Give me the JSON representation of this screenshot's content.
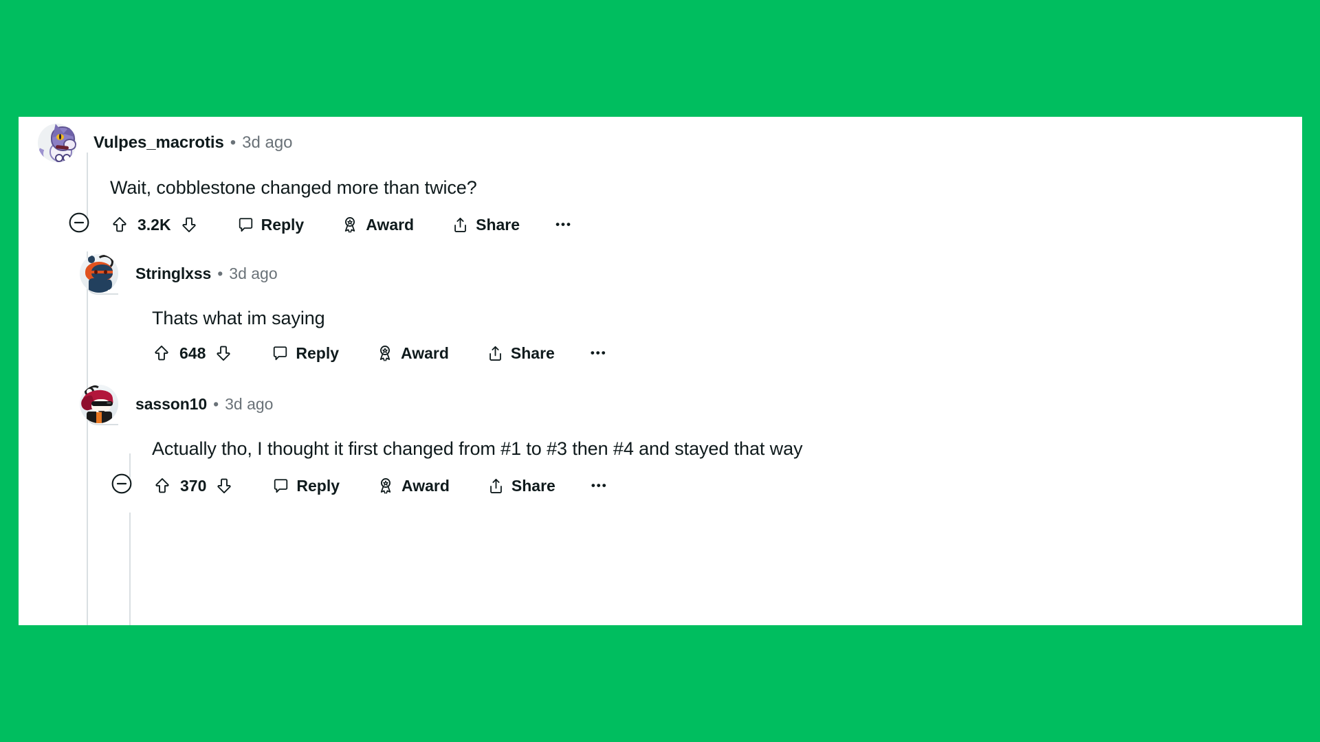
{
  "page": {
    "background_color": "#00be5f",
    "card_background": "#ffffff"
  },
  "comments": [
    {
      "id": "comment-1",
      "username": "Vulpes_macrotis",
      "separator": "•",
      "timestamp": "3d ago",
      "body": "Wait, cobblestone changed more than twice?",
      "avatar_name": "purple-fox-avatar",
      "depth": 0,
      "has_collapse": true,
      "actions": {
        "collapse_icon": "minus-circle-icon",
        "upvote_icon": "upvote-arrow-icon",
        "score": "3.2K",
        "downvote_icon": "downvote-arrow-icon",
        "reply_icon": "comment-bubble-icon",
        "reply_label": "Reply",
        "award_icon": "award-ribbon-icon",
        "award_label": "Award",
        "share_icon": "share-arrow-icon",
        "share_label": "Share",
        "more_label": "•••"
      }
    },
    {
      "id": "comment-2",
      "username": "Stringlxss",
      "separator": "•",
      "timestamp": "3d ago",
      "body": "Thats what im saying",
      "avatar_name": "orange-hood-snoo-avatar",
      "depth": 1,
      "has_collapse": false,
      "actions": {
        "upvote_icon": "upvote-arrow-icon",
        "score": "648",
        "downvote_icon": "downvote-arrow-icon",
        "reply_icon": "comment-bubble-icon",
        "reply_label": "Reply",
        "award_icon": "award-ribbon-icon",
        "award_label": "Award",
        "share_icon": "share-arrow-icon",
        "share_label": "Share",
        "more_label": "•••"
      }
    },
    {
      "id": "comment-3",
      "username": "sasson10",
      "separator": "•",
      "timestamp": "3d ago",
      "body": "Actually tho, I thought it first changed from #1 to #3 then #4 and stayed that way",
      "avatar_name": "red-hair-sunglasses-avatar",
      "depth": 1,
      "has_collapse": true,
      "actions": {
        "collapse_icon": "minus-circle-icon",
        "upvote_icon": "upvote-arrow-icon",
        "score": "370",
        "downvote_icon": "downvote-arrow-icon",
        "reply_icon": "comment-bubble-icon",
        "reply_label": "Reply",
        "award_icon": "award-ribbon-icon",
        "award_label": "Award",
        "share_icon": "share-arrow-icon",
        "share_label": "Share",
        "more_label": "•••"
      }
    }
  ]
}
